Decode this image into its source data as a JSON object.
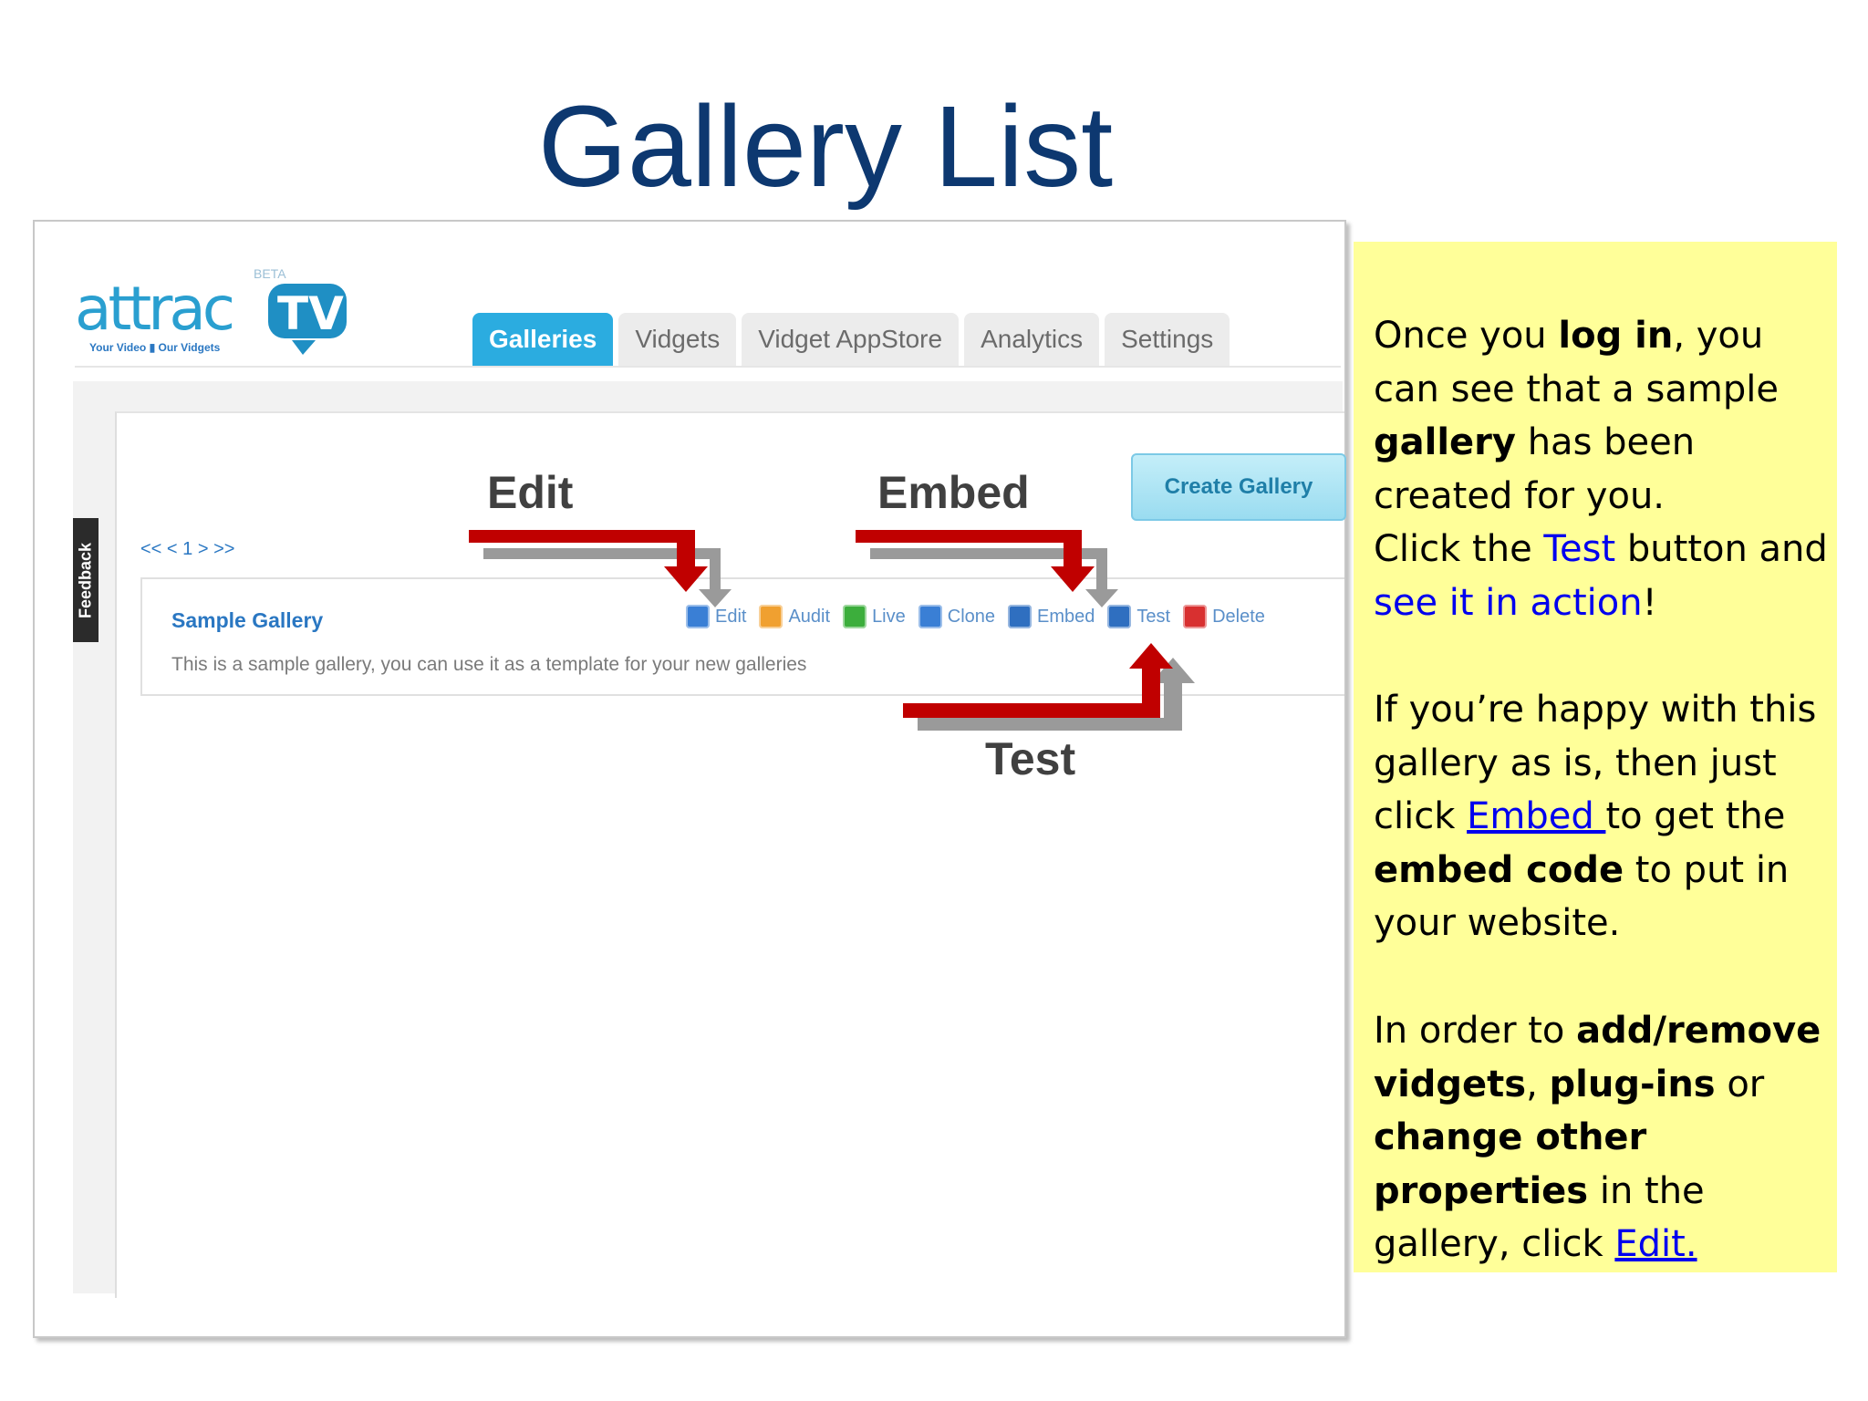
{
  "slide": {
    "title": "Gallery List"
  },
  "app": {
    "logo": {
      "text": "attracTV",
      "beta": "BETA",
      "tagline": "Your Video ▮ Our Vidgets"
    },
    "tabs": [
      {
        "label": "Galleries",
        "active": true
      },
      {
        "label": "Vidgets",
        "active": false
      },
      {
        "label": "Vidget AppStore",
        "active": false
      },
      {
        "label": "Analytics",
        "active": false
      },
      {
        "label": "Settings",
        "active": false
      }
    ],
    "feedback_label": "Feedback",
    "create_button": "Create Gallery",
    "pager": "<< < 1 > >>",
    "gallery": {
      "name": "Sample Gallery",
      "description": "This is a sample gallery, you can use it as a template for your new galleries",
      "actions": [
        {
          "label": "Edit",
          "icon": "edit-icon",
          "color": "#3a7fd5"
        },
        {
          "label": "Audit",
          "icon": "audit-icon",
          "color": "#f0a030"
        },
        {
          "label": "Live",
          "icon": "live-icon",
          "color": "#3cae3c"
        },
        {
          "label": "Clone",
          "icon": "clone-icon",
          "color": "#3a7fd5"
        },
        {
          "label": "Embed",
          "icon": "embed-icon",
          "color": "#2f6fc0"
        },
        {
          "label": "Test",
          "icon": "test-icon",
          "color": "#2f6fc0"
        },
        {
          "label": "Delete",
          "icon": "delete-icon",
          "color": "#d83030"
        }
      ]
    }
  },
  "annotations": {
    "edit": "Edit",
    "embed": "Embed",
    "test": "Test"
  },
  "note": {
    "p1": {
      "t1": "Once you ",
      "b1": "log in",
      "t2": ", you can see that a sample ",
      "b2": "gallery",
      "t3": " has been created for you.",
      "t4": "Click the ",
      "blue1": "Test",
      "t5": " button and ",
      "blue2": "see it in action",
      "t6": "!"
    },
    "p2": {
      "t1": "If you’re happy with this gallery as is, then just click ",
      "link": "Embed ",
      "t2": "to get the ",
      "b1": "embed code",
      "t3": " to put in your website."
    },
    "p3": {
      "t1": "In order to ",
      "b1": "add/remove vidgets",
      "t2": ", ",
      "b2": "plug-ins",
      "t3": " or ",
      "b3": "change other properties",
      "t4": " in the gallery, click ",
      "link": "Edit."
    }
  },
  "colors": {
    "title": "#0d3870",
    "tab_active": "#2bace0",
    "arrow_red": "#c00000",
    "note_bg": "#ffff99",
    "link": "#0000ee"
  }
}
